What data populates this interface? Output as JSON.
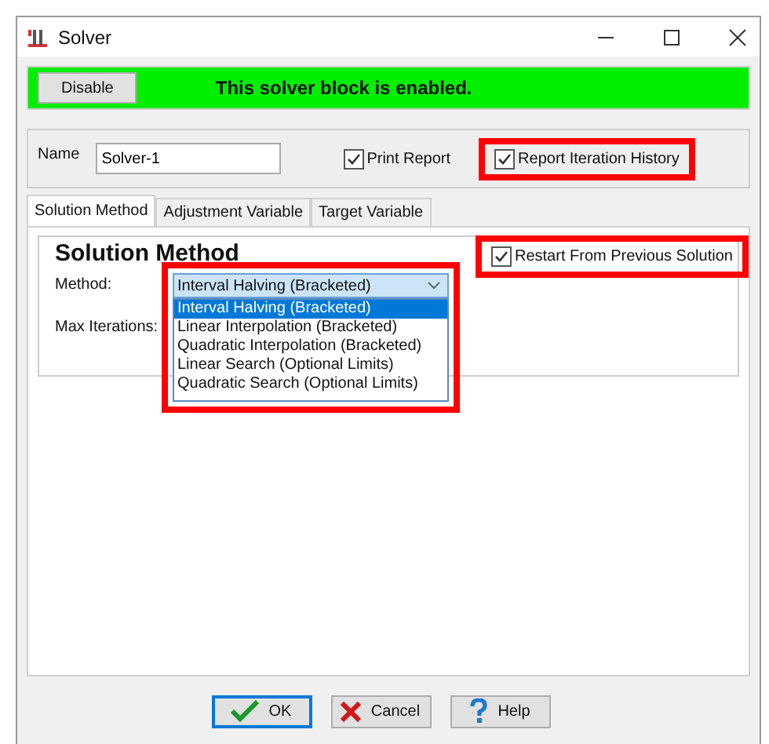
{
  "window": {
    "title": "Solver"
  },
  "status_bar": {
    "button": "Disable",
    "message": "This solver block is enabled.",
    "enabled": true
  },
  "name_field": {
    "label": "Name",
    "value": "Solver-1"
  },
  "options": [
    {
      "label": "Print Report",
      "checked": true,
      "highlighted": false
    },
    {
      "label": "Report Iteration History",
      "checked": true,
      "highlighted": true
    }
  ],
  "tabs": [
    {
      "label": "Solution Method",
      "selected": true
    },
    {
      "label": "Adjustment Variable",
      "selected": false
    },
    {
      "label": "Target Variable",
      "selected": false
    }
  ],
  "section": {
    "title": "Solution Method",
    "method_label": "Method:",
    "max_iterations_label": "Max Iterations:",
    "method": {
      "value": "Interval Halving (Bracketed)",
      "highlighted": true,
      "expanded": true,
      "options": [
        {
          "label": "Interval Halving (Bracketed)",
          "selected": true
        },
        {
          "label": "Linear Interpolation (Bracketed)",
          "selected": false
        },
        {
          "label": "Quadratic Interpolation (Bracketed)",
          "selected": false
        },
        {
          "label": "Linear Search (Optional Limits)",
          "selected": false
        },
        {
          "label": "Quadratic Search (Optional Limits)",
          "selected": false
        }
      ]
    },
    "restart": {
      "label": "Restart From Previous Solution",
      "checked": true,
      "highlighted": true
    }
  },
  "buttons": [
    {
      "label": "OK",
      "kind": "ok",
      "default": true
    },
    {
      "label": "Cancel",
      "kind": "cancel",
      "default": false
    },
    {
      "label": "Help",
      "kind": "help",
      "default": false
    }
  ]
}
